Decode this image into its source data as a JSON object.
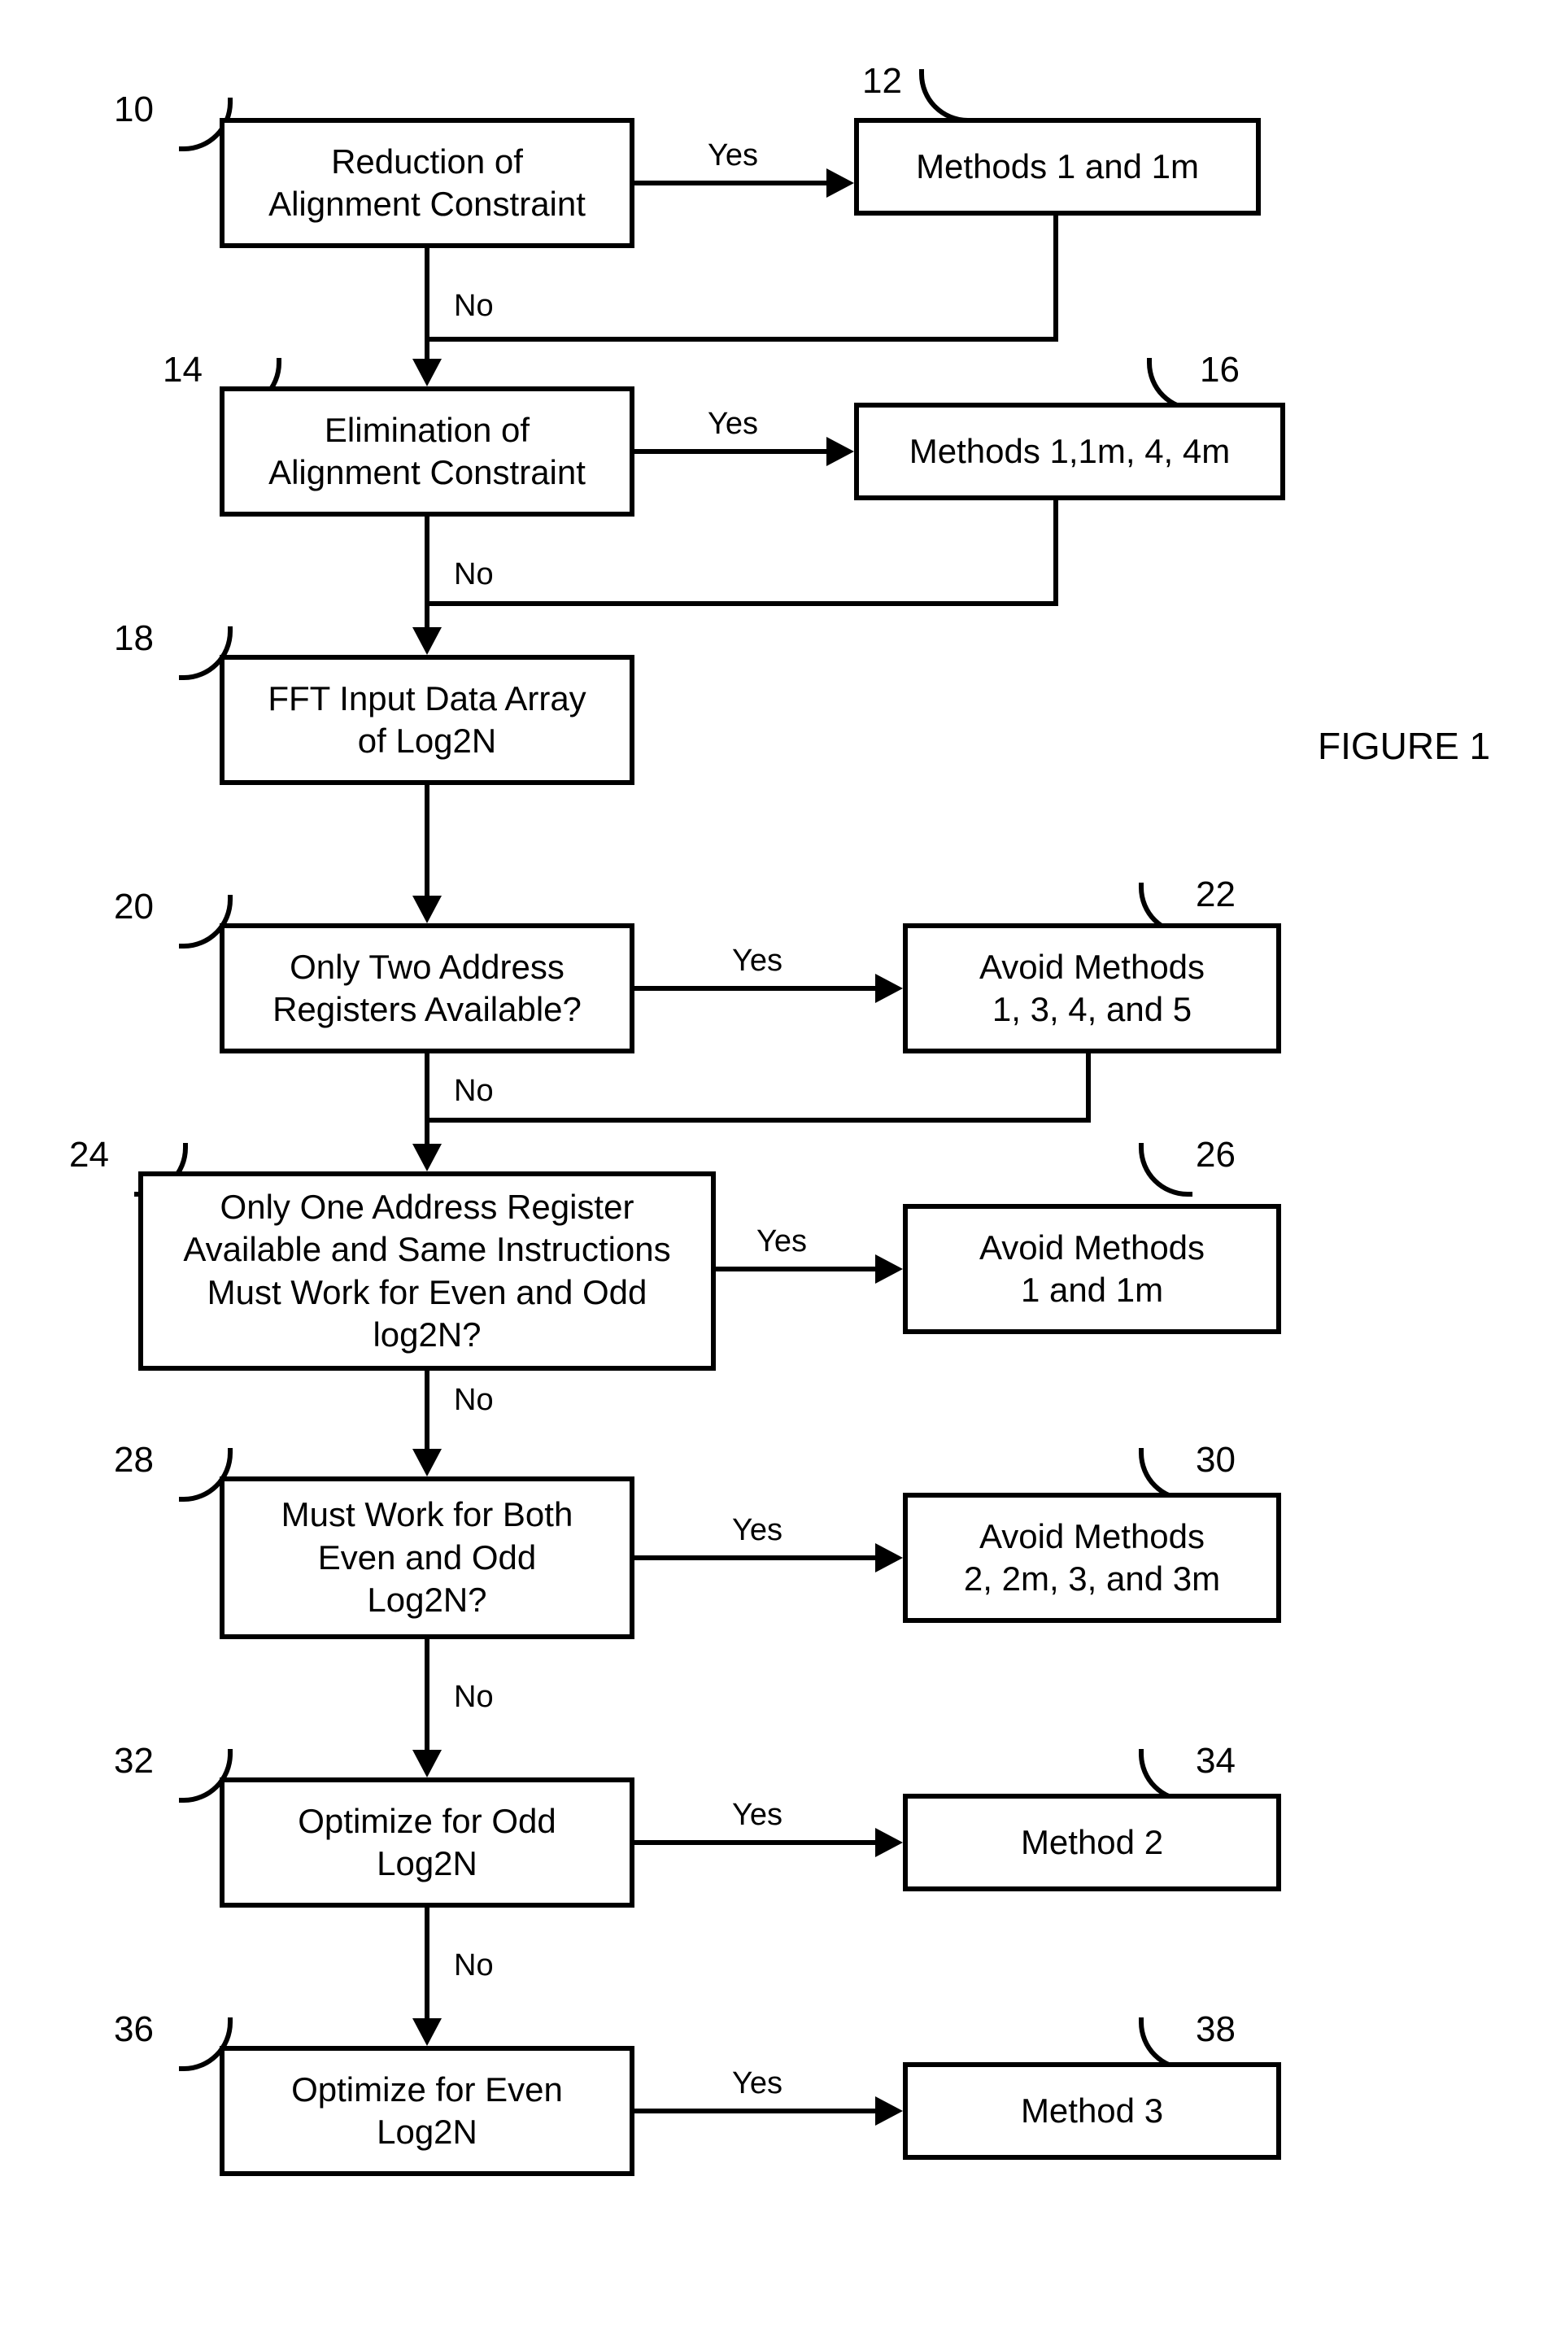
{
  "figure_label": "FIGURE 1",
  "nodes": {
    "n10": {
      "num": "10",
      "text": "Reduction of\nAlignment Constraint"
    },
    "n12": {
      "num": "12",
      "text": "Methods 1 and 1m"
    },
    "n14": {
      "num": "14",
      "text": "Elimination of\nAlignment Constraint"
    },
    "n16": {
      "num": "16",
      "text": "Methods 1,1m, 4, 4m"
    },
    "n18": {
      "num": "18",
      "text": "FFT Input Data Array\nof Log2N"
    },
    "n20": {
      "num": "20",
      "text": "Only Two Address\nRegisters Available?"
    },
    "n22": {
      "num": "22",
      "text": "Avoid Methods\n1, 3, 4, and 5"
    },
    "n24": {
      "num": "24",
      "text": "Only One Address Register\nAvailable and Same Instructions\nMust Work for Even and Odd\nlog2N?"
    },
    "n26": {
      "num": "26",
      "text": "Avoid Methods\n1 and 1m"
    },
    "n28": {
      "num": "28",
      "text": "Must Work for Both\nEven and Odd\nLog2N?"
    },
    "n30": {
      "num": "30",
      "text": "Avoid Methods\n2, 2m, 3, and 3m"
    },
    "n32": {
      "num": "32",
      "text": "Optimize for Odd\nLog2N"
    },
    "n34": {
      "num": "34",
      "text": "Method 2"
    },
    "n36": {
      "num": "36",
      "text": "Optimize for Even\nLog2N"
    },
    "n38": {
      "num": "38",
      "text": "Method 3"
    }
  },
  "edge_labels": {
    "yes": "Yes",
    "no": "No"
  }
}
